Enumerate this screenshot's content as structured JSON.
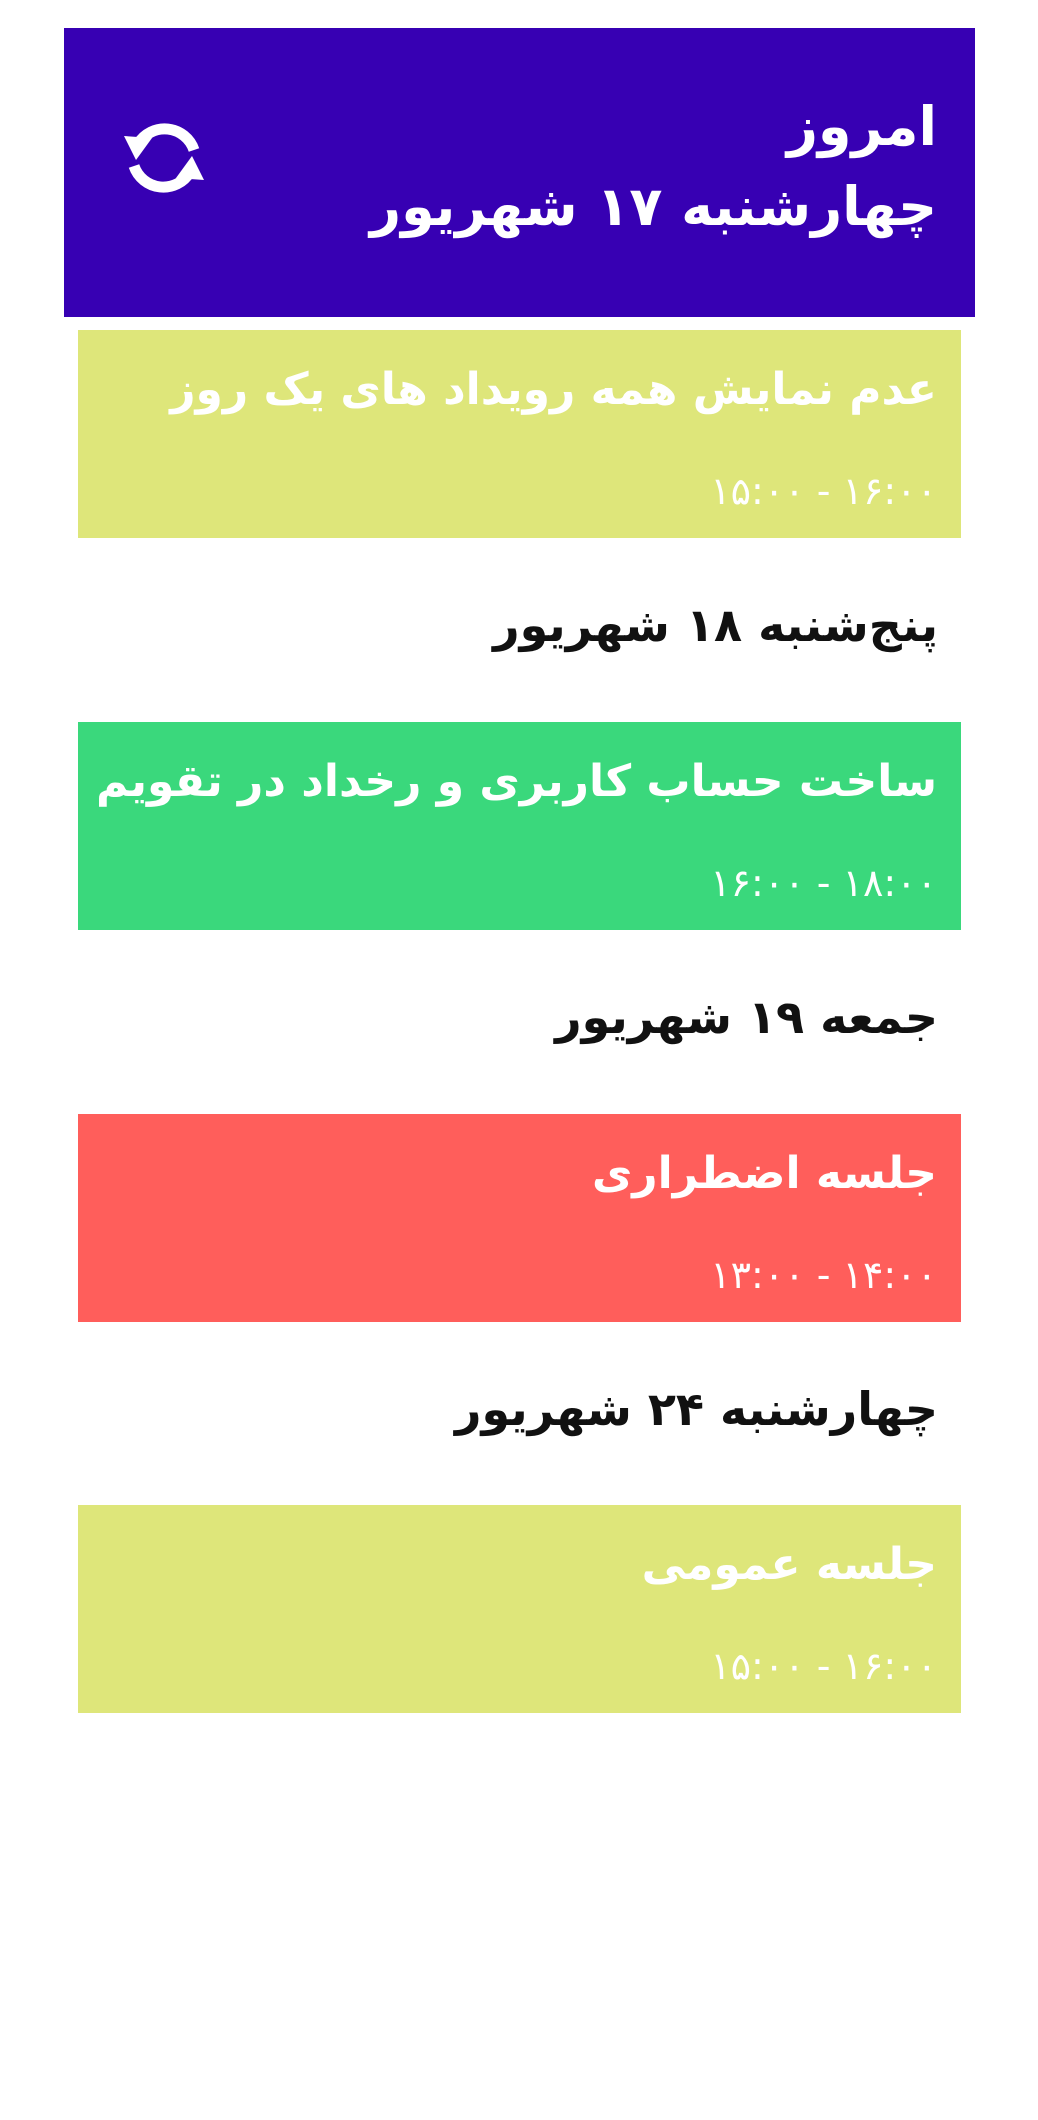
{
  "header": {
    "label": "امروز",
    "date": "چهارشنبه ۱۷ شهریور",
    "background": "#3700b3",
    "refresh_icon": "refresh-icon"
  },
  "today_events": [
    {
      "title": "عدم نمایش همه رویداد های یک روز",
      "time": "۱۶:۰۰ - ۱۵:۰۰",
      "color": "#dee67a"
    }
  ],
  "days": [
    {
      "heading": "پنج‌شنبه ۱۸ شهریور",
      "events": [
        {
          "title": "ساخت حساب کاربری و رخداد در تقویم",
          "time": "۱۸:۰۰ - ۱۶:۰۰",
          "color": "#3ad87c"
        }
      ]
    },
    {
      "heading": "جمعه ۱۹ شهریور",
      "events": [
        {
          "title": "جلسه اضطراری",
          "time": "۱۴:۰۰ - ۱۳:۰۰",
          "color": "#ff5e5b"
        }
      ]
    },
    {
      "heading": "چهارشنبه ۲۴ شهریور",
      "events": [
        {
          "title": "جلسه عمومی",
          "time": "۱۶:۰۰ - ۱۵:۰۰",
          "color": "#dee67a"
        }
      ]
    }
  ]
}
